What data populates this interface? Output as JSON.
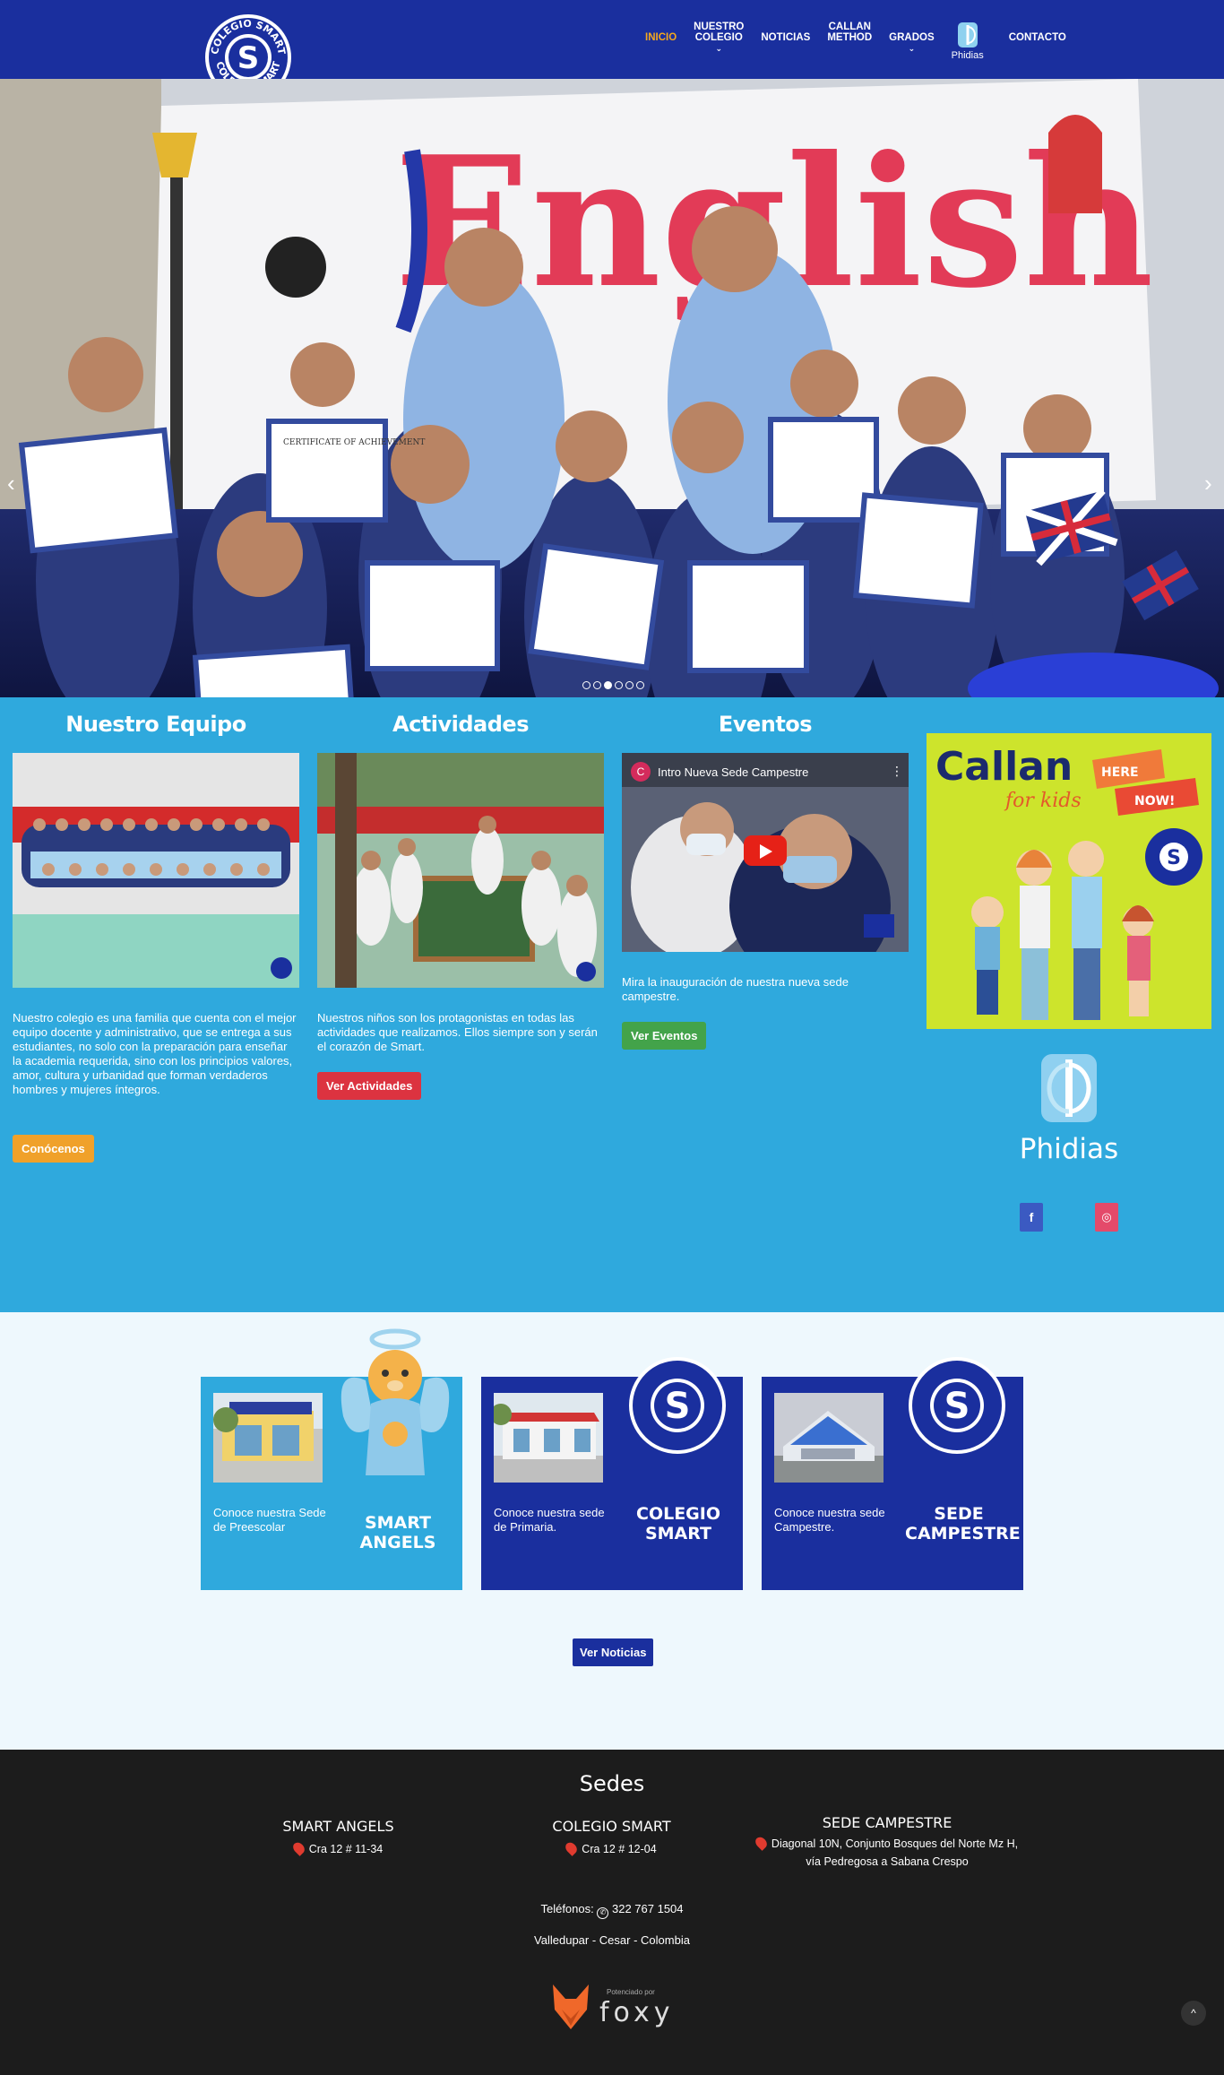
{
  "nav": {
    "logo_text": "COLEGIO SMART",
    "items": [
      {
        "label": "INICIO",
        "active": true
      },
      {
        "label": "NUESTRO\nCOLEGIO",
        "dropdown": true
      },
      {
        "label": "NOTICIAS"
      },
      {
        "label": "CALLAN\nMETHOD"
      },
      {
        "label": "GRADOS",
        "dropdown": true
      },
      {
        "label": "Phidias"
      },
      {
        "label": "CONTACTO"
      }
    ]
  },
  "hero": {
    "prev_arrow": "‹",
    "next_arrow": "›",
    "slides": 6,
    "active_slide": 3,
    "banner_text": "English",
    "certificate_text": "CERTIFICATE OF ACHIEVEMENT"
  },
  "equipo": {
    "title": "Nuestro Equipo",
    "text": "Nuestro colegio es una familia que cuenta con el mejor equipo docente y administrativo, que se entrega a sus estudiantes, no solo con la preparación para enseñar la academia requerida, sino con los principios valores, amor, cultura y urbanidad que forman verdaderos hombres y mujeres íntegros.",
    "button": "Conócenos"
  },
  "actividades": {
    "title": "Actividades",
    "text": "Nuestros niños son los protagonistas en todas las actividades que realizamos. Ellos siempre son y serán el corazón de Smart.",
    "button": "Ver Actividades"
  },
  "eventos": {
    "title": "Eventos",
    "video_title": "Intro Nueva Sede Campestre",
    "video_channel_initial": "C",
    "text": "Mira la inauguración de nuestra nueva sede campestre.",
    "button": "Ver Eventos"
  },
  "callan": {
    "title": "Callan",
    "subtitle": "for kids",
    "badge1": "HERE",
    "badge2": "NOW!"
  },
  "phidias": {
    "label": "Phidias",
    "facebook": "f",
    "instagram": "◎"
  },
  "sedes_cards": [
    {
      "text": "Conoce nuestra Sede de Preescolar",
      "title": "SMART\nANGELS",
      "bg": "#2fa9dd"
    },
    {
      "text": "Conoce nuestra sede de Primaria.",
      "title": "COLEGIO\nSMART",
      "bg": "#1a2f9e"
    },
    {
      "text": "Conoce nuestra sede Campestre.",
      "title": "SEDE\nCAMPESTRE",
      "bg": "#1a2f9e"
    }
  ],
  "ver_noticias": "Ver Noticias",
  "footer": {
    "title": "Sedes",
    "sedes": [
      {
        "name": "SMART ANGELS",
        "address": "Cra 12 # 11-34"
      },
      {
        "name": "COLEGIO SMART",
        "address": "Cra 12 # 12-04"
      },
      {
        "name": "SEDE CAMPESTRE",
        "address": "Diagonal 10N, Conjunto Bosques del Norte Mz H, vía Pedregosa a Sabana Crespo"
      }
    ],
    "phones_label": "Teléfonos:",
    "phone": "322 767 1504",
    "city": "Valledupar - Cesar - Colombia",
    "powered_by": "Potenciado por",
    "brand": "foxy",
    "to_top": "^"
  },
  "colors": {
    "nav_bg": "#1a2f9e",
    "section_blue": "#2fa9dd",
    "accent_orange": "#f5a81e",
    "btn_red": "#dc3340",
    "btn_green": "#43a34a",
    "footer_bg": "#1c1c1c"
  }
}
